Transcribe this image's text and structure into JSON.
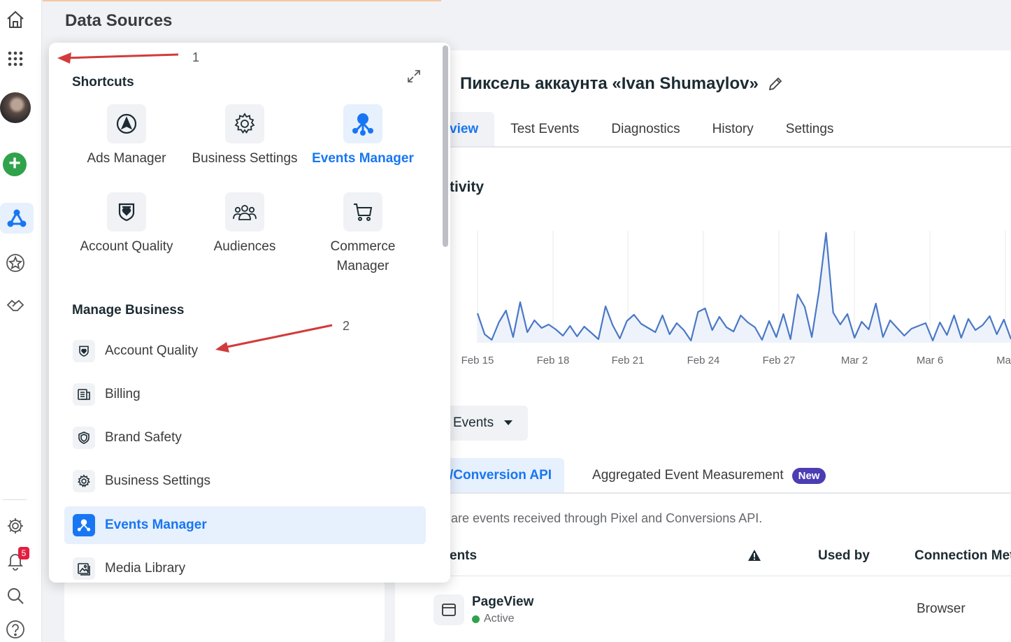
{
  "page": {
    "title": "Data Sources"
  },
  "colors": {
    "accent": "#1876f2",
    "annotation_arrow": "#d23b3b",
    "new_badge": "#4b3db3",
    "active_dot": "#31a24c",
    "notification": "#e41e3f"
  },
  "rail": {
    "icons": [
      "home-icon",
      "apps-grid-icon",
      "avatar",
      "add-icon",
      "events-manager-icon",
      "star-icon",
      "handshake-icon",
      "settings-icon",
      "bell-icon",
      "search-icon",
      "help-icon"
    ],
    "notification_count": "5"
  },
  "popover": {
    "shortcuts_title": "Shortcuts",
    "shortcuts": [
      {
        "label": "Ads Manager",
        "icon": "ads-manager-icon",
        "active": false
      },
      {
        "label": "Business Settings",
        "icon": "gear-icon",
        "active": false
      },
      {
        "label": "Events Manager",
        "icon": "events-manager-icon",
        "active": true
      },
      {
        "label": "Account Quality",
        "icon": "shield-heart-icon",
        "active": false
      },
      {
        "label": "Audiences",
        "icon": "audiences-icon",
        "active": false
      },
      {
        "label": "Commerce Manager",
        "icon": "cart-icon",
        "active": false
      }
    ],
    "manage_title": "Manage Business",
    "manage_items": [
      {
        "label": "Account Quality",
        "icon": "shield-heart-icon",
        "active": false
      },
      {
        "label": "Billing",
        "icon": "billing-icon",
        "active": false
      },
      {
        "label": "Brand Safety",
        "icon": "brand-safety-icon",
        "active": false
      },
      {
        "label": "Business Settings",
        "icon": "gear-icon",
        "active": false
      },
      {
        "label": "Events Manager",
        "icon": "events-manager-icon",
        "active": true
      },
      {
        "label": "Media Library",
        "icon": "media-library-icon",
        "active": false
      }
    ],
    "annotations": [
      "1",
      "2"
    ]
  },
  "main": {
    "pixel_title": "Пиксель аккаунта «Ivan Shumaylov»",
    "tabs": [
      "view",
      "Test Events",
      "Diagnostics",
      "History",
      "Settings"
    ],
    "activity_title": "tivity",
    "events_dropdown": "Events",
    "subtabs": [
      "/Conversion API",
      "Aggregated Event Measurement"
    ],
    "new_badge": "New",
    "description": "are events received through Pixel and Conversions API.",
    "table": {
      "headers": [
        "ents",
        "Used by",
        "Connection Met"
      ],
      "row": {
        "name": "PageView",
        "status": "Active",
        "connection": "Browser"
      }
    }
  },
  "chart_data": {
    "type": "line",
    "x_ticks": [
      "Feb 15",
      "Feb 18",
      "Feb 21",
      "Feb 24",
      "Feb 27",
      "Mar 2",
      "Mar 6",
      "Mar"
    ],
    "series": [
      {
        "values": [
          4.2,
          1.2,
          0.4,
          2.9,
          4.6,
          0.8,
          5.8,
          1.5,
          3.2,
          2.1,
          2.6,
          1.9,
          1.0,
          2.4,
          0.9,
          2.3,
          1.4,
          0.5,
          5.2,
          2.5,
          0.6,
          3.1,
          4.0,
          2.7,
          2.1,
          1.5,
          3.9,
          1.2,
          2.8,
          1.8,
          0.3,
          4.4,
          4.9,
          1.8,
          3.7,
          2.2,
          1.6,
          3.9,
          2.9,
          2.2,
          0.4,
          3.1,
          0.8,
          4.1,
          0.5,
          6.9,
          5.1,
          0.8,
          7.3,
          15.7,
          4.3,
          2.6,
          4.1,
          0.7,
          3.0,
          1.9,
          5.6,
          0.8,
          3.2,
          2.1,
          1.0,
          2.0,
          2.4,
          2.8,
          0.3,
          2.9,
          1.1,
          3.9,
          0.7,
          3.4,
          1.8,
          2.5,
          3.8,
          1.2,
          3.3,
          0.5
        ]
      }
    ],
    "grid": "vertical"
  }
}
